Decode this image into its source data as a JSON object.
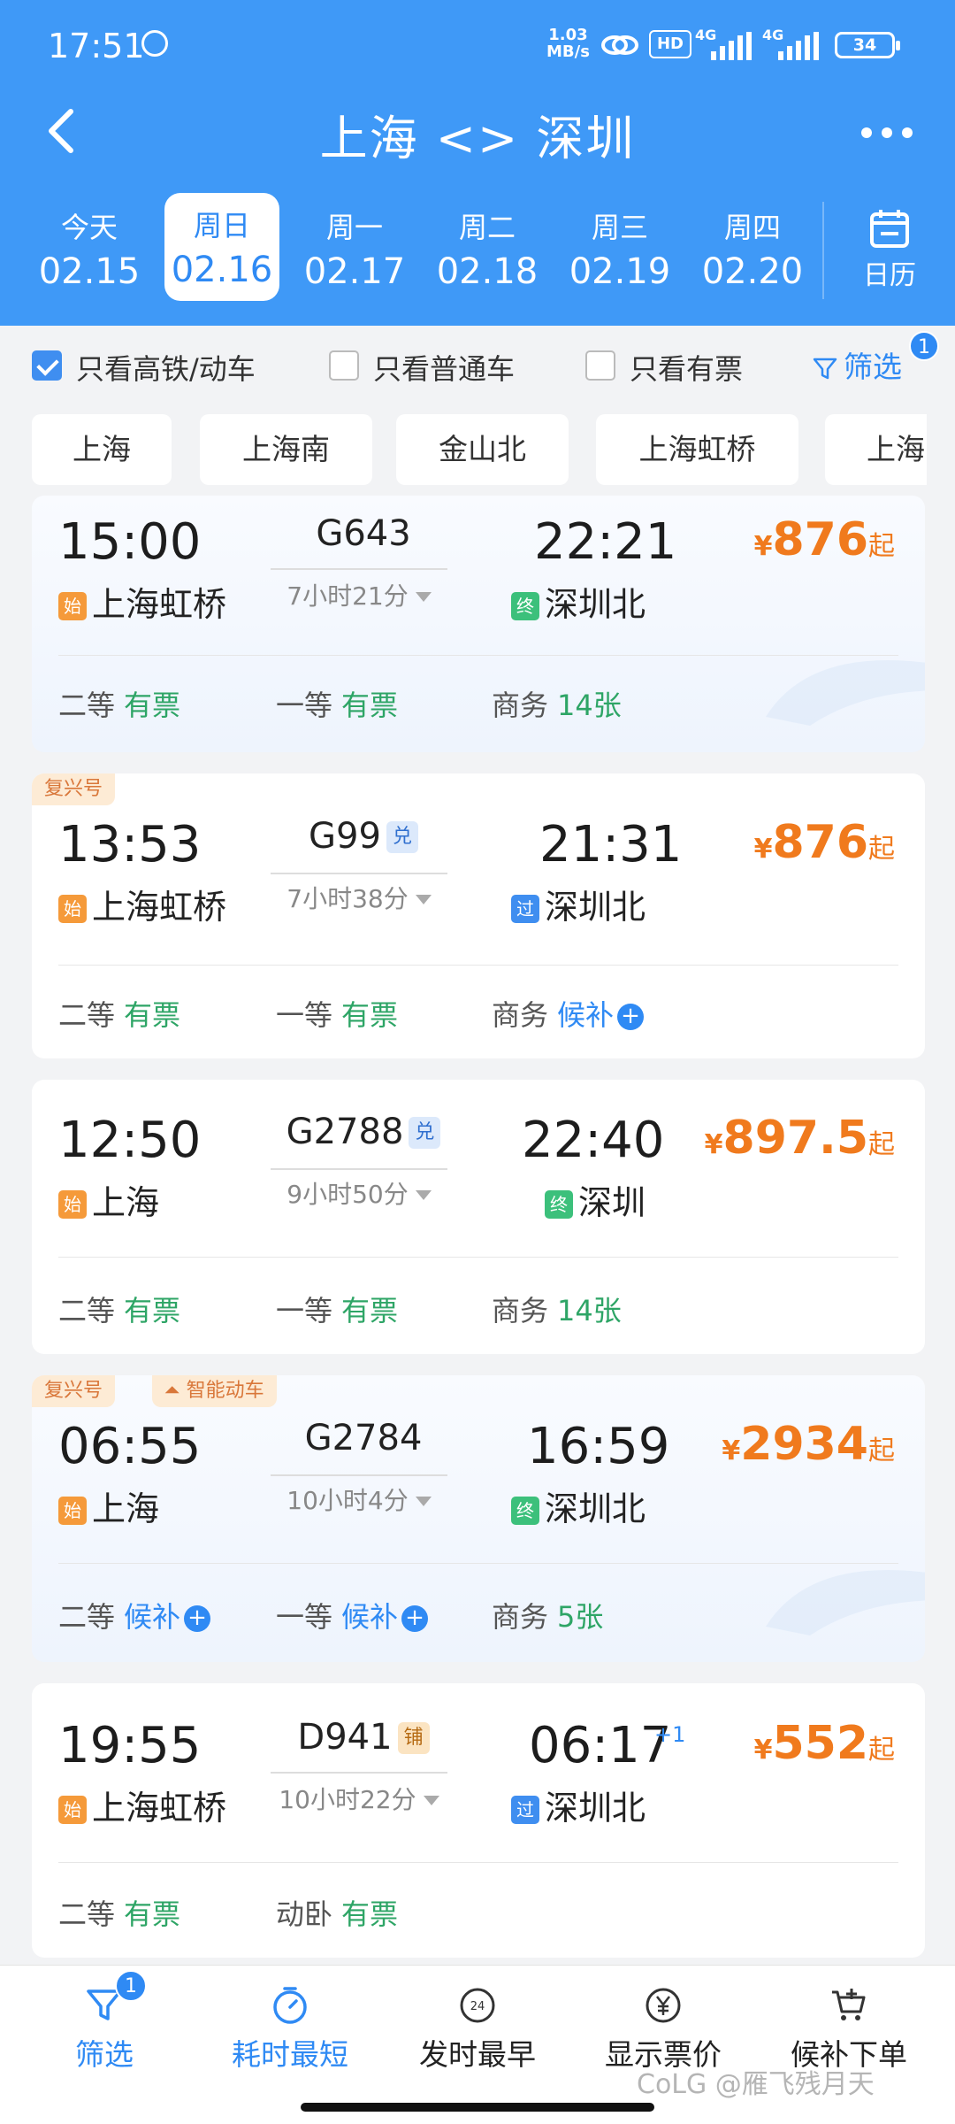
{
  "status": {
    "time": "17:51",
    "net_speed": "1.03",
    "net_unit": "MB/s",
    "hd": "HD",
    "sig1": "4G",
    "sig2": "4G",
    "battery": "34"
  },
  "nav": {
    "title": "上海 <> 深圳"
  },
  "dates": [
    {
      "weekday": "今天",
      "date": "02.15"
    },
    {
      "weekday": "周日",
      "date": "02.16"
    },
    {
      "weekday": "周一",
      "date": "02.17"
    },
    {
      "weekday": "周二",
      "date": "02.18"
    },
    {
      "weekday": "周三",
      "date": "02.19"
    },
    {
      "weekday": "周四",
      "date": "02.20"
    }
  ],
  "calendar_label": "日历",
  "filters": {
    "gaotie": "只看高铁/动车",
    "putong": "只看普通车",
    "youpiao": "只看有票",
    "screen": "筛选",
    "screen_badge": "1"
  },
  "stations": [
    "上海",
    "上海南",
    "金山北",
    "上海虹桥",
    "上海"
  ],
  "trains": [
    {
      "tags": [],
      "dep": "15:00",
      "arr": "22:21",
      "arr_plus": "",
      "no": "G643",
      "badge": "",
      "dur": "7小时21分",
      "from_icon": "始",
      "from": "上海虹桥",
      "to_icon": "终",
      "to": "深圳北",
      "yen": "¥",
      "price": "876",
      "qi": "起",
      "seats": [
        {
          "name": "二等",
          "val": "有票"
        },
        {
          "name": "一等",
          "val": "有票"
        },
        {
          "name": "商务",
          "val": "14张"
        }
      ]
    },
    {
      "tags": [
        "复兴号"
      ],
      "dep": "13:53",
      "arr": "21:31",
      "arr_plus": "",
      "no": "G99",
      "badge": "兑",
      "dur": "7小时38分",
      "from_icon": "始",
      "from": "上海虹桥",
      "to_icon": "过",
      "to": "深圳北",
      "yen": "¥",
      "price": "876",
      "qi": "起",
      "seats": [
        {
          "name": "二等",
          "val": "有票"
        },
        {
          "name": "一等",
          "val": "有票"
        },
        {
          "name": "商务",
          "val": "候补"
        }
      ]
    },
    {
      "tags": [],
      "dep": "12:50",
      "arr": "22:40",
      "arr_plus": "",
      "no": "G2788",
      "badge": "兑",
      "dur": "9小时50分",
      "from_icon": "始",
      "from": "上海",
      "to_icon": "终",
      "to": "深圳",
      "yen": "¥",
      "price": "897.5",
      "qi": "起",
      "seats": [
        {
          "name": "二等",
          "val": "有票"
        },
        {
          "name": "一等",
          "val": "有票"
        },
        {
          "name": "商务",
          "val": "14张"
        }
      ]
    },
    {
      "tags": [
        "复兴号",
        "智能动车"
      ],
      "dep": "06:55",
      "arr": "16:59",
      "arr_plus": "",
      "no": "G2784",
      "badge": "",
      "dur": "10小时4分",
      "from_icon": "始",
      "from": "上海",
      "to_icon": "终",
      "to": "深圳北",
      "yen": "¥",
      "price": "2934",
      "qi": "起",
      "seats": [
        {
          "name": "二等",
          "val": "候补"
        },
        {
          "name": "一等",
          "val": "候补"
        },
        {
          "name": "商务",
          "val": "5张"
        }
      ]
    },
    {
      "tags": [],
      "dep": "19:55",
      "arr": "06:17",
      "arr_plus": "+1",
      "no": "D941",
      "badge": "铺",
      "dur": "10小时22分",
      "from_icon": "始",
      "from": "上海虹桥",
      "to_icon": "过",
      "to": "深圳北",
      "yen": "¥",
      "price": "552",
      "qi": "起",
      "seats": [
        {
          "name": "二等",
          "val": "有票"
        },
        {
          "name": "动卧",
          "val": "有票"
        }
      ]
    }
  ],
  "bottom": {
    "filter": "筛选",
    "filter_badge": "1",
    "shortest": "耗时最短",
    "earliest": "发时最早",
    "price": "显示票价",
    "waitlist": "候补下单",
    "clock_num": "24"
  },
  "watermark": "CoLG @雁飞残月天",
  "colors": {
    "primary": "#3f99f7",
    "accent_blue": "#2f8af4",
    "price_orange": "#f07a1d",
    "green": "#2ea566"
  }
}
